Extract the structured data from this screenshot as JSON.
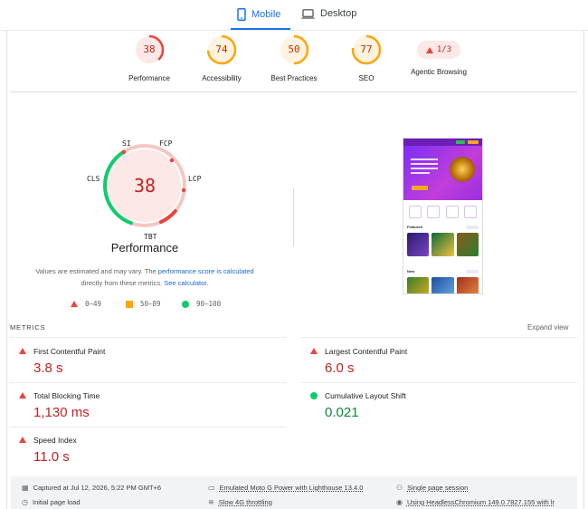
{
  "tabs": {
    "mobile": "Mobile",
    "desktop": "Desktop"
  },
  "categories": [
    {
      "label": "Performance",
      "score": "38",
      "color": "#e8453c",
      "bg": "#fce8e6",
      "fraction": 0.38
    },
    {
      "label": "Accessibility",
      "score": "74",
      "color": "#ffa400",
      "bg": "#fff3e0",
      "fraction": 0.74
    },
    {
      "label": "Best Practices",
      "score": "50",
      "color": "#ffa400",
      "bg": "#fff3e0",
      "fraction": 0.5
    },
    {
      "label": "SEO",
      "score": "77",
      "color": "#ffa400",
      "bg": "#fff3e0",
      "fraction": 0.77
    }
  ],
  "agentic": {
    "label": "Agentic Browsing",
    "value": "1/3"
  },
  "perf_gauge": {
    "score": "38",
    "title": "Performance",
    "tags": {
      "si": "SI",
      "fcp": "FCP",
      "lcp": "LCP",
      "tbt": "TBT",
      "cls": "CLS"
    }
  },
  "note": {
    "text1": "Values are estimated and may vary. The ",
    "link1": "performance score is calculated",
    "text2": " directly from these metrics. ",
    "link2": "See calculator."
  },
  "legend": {
    "poor": "0–49",
    "average": "50–89",
    "good": "90–100"
  },
  "colors": {
    "poor": "#e8453c",
    "average": "#ffa400",
    "good": "#0cce6b",
    "accent": "#1a73e8"
  },
  "phone": {
    "sec1": "Featured",
    "sec2": "New"
  },
  "metrics": {
    "header": "METRICS",
    "expand": "Expand view",
    "items": [
      {
        "name": "First Contentful Paint",
        "value": "3.8 s",
        "status": "poor"
      },
      {
        "name": "Largest Contentful Paint",
        "value": "6.0 s",
        "status": "poor"
      },
      {
        "name": "Total Blocking Time",
        "value": "1,130 ms",
        "status": "poor"
      },
      {
        "name": "Cumulative Layout Shift",
        "value": "0.021",
        "status": "good"
      },
      {
        "name": "Speed Index",
        "value": "11.0 s",
        "status": "poor"
      }
    ]
  },
  "runtime": {
    "captured": "Captured at Jul 12, 2026, 5:22 PM GMT+6",
    "device": "Emulated Moto G Power with Lighthouse 13.4.0",
    "session": "Single page session",
    "load": "Initial page load",
    "throttling": "Slow 4G throttling",
    "browser": "Using HeadlessChromium 149.0.7827.155 with lr"
  }
}
